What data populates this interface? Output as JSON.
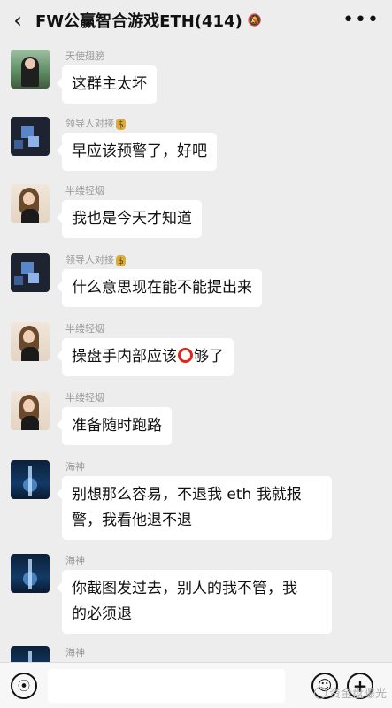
{
  "header": {
    "back_icon": "chevron-left-icon",
    "title": "FW公赢智合游戏ETH(414)",
    "mute_icon": "bell-off-icon",
    "more_icon": "more-dots-icon"
  },
  "messages": [
    {
      "sender": "天使翅膀",
      "text": "这群主太坏",
      "avatar": "angel-avatar"
    },
    {
      "sender": "领导人对接",
      "sender_badge": "$",
      "text": "早应该预警了，好吧",
      "avatar": "pixel-avatar"
    },
    {
      "sender": "半缕轻烟",
      "text": "我也是今天才知道",
      "avatar": "girl-avatar"
    },
    {
      "sender": "领导人对接",
      "sender_badge": "$",
      "text": "什么意思现在能不能提出来",
      "avatar": "pixel-avatar"
    },
    {
      "sender": "半缕轻烟",
      "text_before": "操盘手内部应该",
      "text_after": "够了",
      "avatar": "girl-avatar"
    },
    {
      "sender": "半缕轻烟",
      "text": "准备随时跑路",
      "avatar": "girl-avatar"
    },
    {
      "sender": "海神",
      "line1": "别想那么容易，不退我 eth 我就报",
      "line2": "警，我看他退不退",
      "avatar": "sea-avatar"
    },
    {
      "sender": "海神",
      "line1": "你截图发过去，别人的我不管，我",
      "line2": "的必须退",
      "avatar": "sea-avatar"
    },
    {
      "sender": "海神"
    }
  ],
  "input_bar": {
    "voice_icon": "voice-icon",
    "emoji_icon": "emoji-icon",
    "plus_icon": "plus-icon",
    "watermark": "资金盘曝光"
  }
}
